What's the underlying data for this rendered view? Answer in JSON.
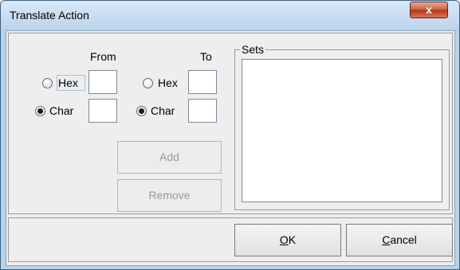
{
  "window": {
    "title": "Translate Action",
    "close_glyph": "x"
  },
  "from": {
    "header": "From",
    "hex_label": "Hex",
    "char_label": "Char",
    "selected": "char"
  },
  "to": {
    "header": "To",
    "hex_label": "Hex",
    "char_label": "Char",
    "selected": "char"
  },
  "buttons": {
    "add_label": "Add",
    "remove_label": "Remove",
    "ok_mnemonic": "O",
    "ok_rest": "K",
    "cancel_mnemonic": "C",
    "cancel_rest": "ancel"
  },
  "sets": {
    "title": "Sets",
    "items": []
  },
  "colors": {
    "title_bar": "#c8dcf0",
    "close_button": "#c65b41",
    "dialog_bg": "#eeeeee"
  }
}
